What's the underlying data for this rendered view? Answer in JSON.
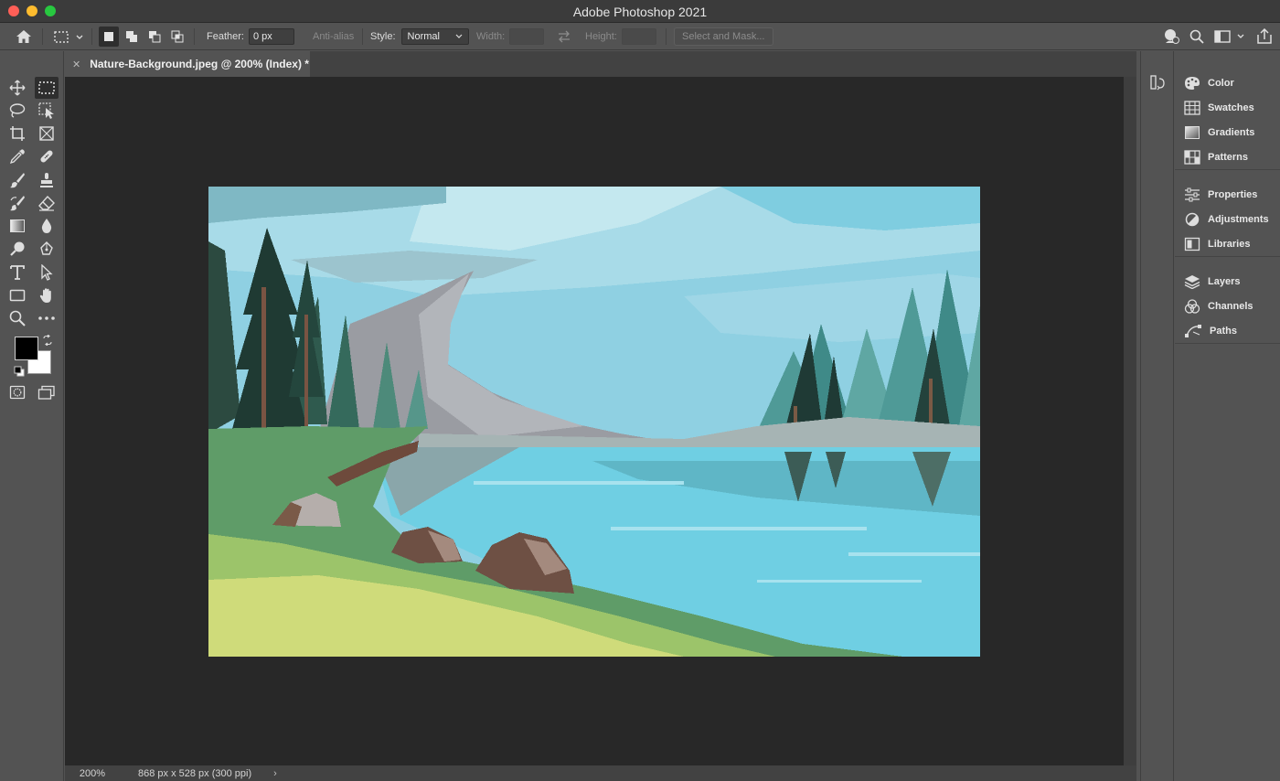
{
  "window": {
    "title": "Adobe Photoshop 2021"
  },
  "options_bar": {
    "feather_label": "Feather:",
    "feather_value": "0 px",
    "anti_alias_label": "Anti-alias",
    "style_label": "Style:",
    "style_value": "Normal",
    "width_label": "Width:",
    "height_label": "Height:",
    "select_mask_label": "Select and Mask..."
  },
  "document": {
    "tab_label": "Nature-Background.jpeg @ 200% (Index) *",
    "zoom": "200%",
    "doc_size": "868 px x 528 px (300 ppi)"
  },
  "tools": [
    "move-tool",
    "marquee-tool",
    "lasso-tool",
    "object-selection-tool",
    "crop-tool",
    "frame-tool",
    "eyedropper-tool",
    "healing-brush-tool",
    "brush-tool",
    "stamp-tool",
    "history-brush-tool",
    "eraser-tool",
    "gradient-tool",
    "blur-tool",
    "dodge-tool",
    "pen-tool",
    "type-tool",
    "path-selection-tool",
    "rectangle-tool",
    "hand-tool",
    "zoom-tool",
    "more-tools"
  ],
  "colors": {
    "foreground": "#000000",
    "background": "#ffffff"
  },
  "panels": {
    "group1": [
      "Color",
      "Swatches",
      "Gradients",
      "Patterns"
    ],
    "group2": [
      "Properties",
      "Adjustments",
      "Libraries"
    ],
    "group3": [
      "Layers",
      "Channels",
      "Paths"
    ]
  }
}
